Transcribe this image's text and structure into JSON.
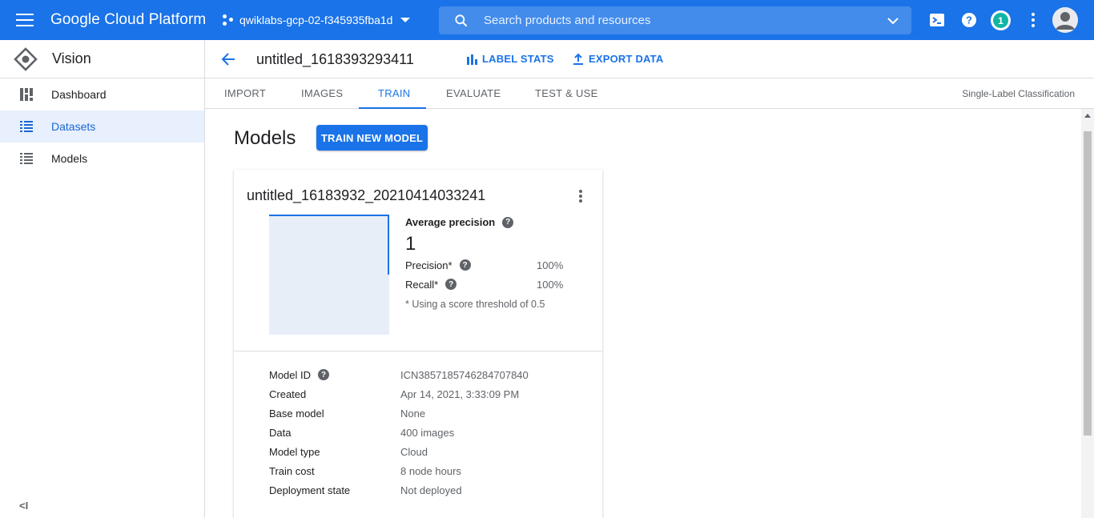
{
  "topbar": {
    "brand": "Google Cloud Platform",
    "project": "qwiklabs-gcp-02-f345935fba1d",
    "search_placeholder": "Search products and resources",
    "notification_count": "1",
    "accent": "#1a73e8"
  },
  "sidebar": {
    "title": "Vision",
    "items": [
      {
        "label": "Dashboard",
        "icon": "dashboard-icon"
      },
      {
        "label": "Datasets",
        "icon": "list-icon",
        "active": true
      },
      {
        "label": "Models",
        "icon": "list-icon"
      }
    ],
    "collapse_label": "<I"
  },
  "header": {
    "dataset_title": "untitled_1618393293411",
    "label_stats": "LABEL STATS",
    "export_data": "EXPORT DATA"
  },
  "tabs": {
    "items": [
      "IMPORT",
      "IMAGES",
      "TRAIN",
      "EVALUATE",
      "TEST & USE"
    ],
    "active": "TRAIN",
    "classification": "Single-Label Classification"
  },
  "main": {
    "title": "Models",
    "train_button": "TRAIN NEW MODEL",
    "model": {
      "name": "untitled_16183932_20210414033241",
      "avg_precision_label": "Average precision",
      "avg_precision_value": "1",
      "precision_label": "Precision*",
      "precision_value": "100%",
      "recall_label": "Recall*",
      "recall_value": "100%",
      "threshold_note": "* Using a score threshold of 0.5",
      "properties": [
        {
          "key": "Model ID",
          "value": "ICN3857185746284707840",
          "help": true
        },
        {
          "key": "Created",
          "value": "Apr 14, 2021, 3:33:09 PM"
        },
        {
          "key": "Base model",
          "value": "None"
        },
        {
          "key": "Data",
          "value": "400 images"
        },
        {
          "key": "Model type",
          "value": "Cloud"
        },
        {
          "key": "Train cost",
          "value": "8 node hours"
        },
        {
          "key": "Deployment state",
          "value": "Not deployed"
        }
      ]
    }
  }
}
